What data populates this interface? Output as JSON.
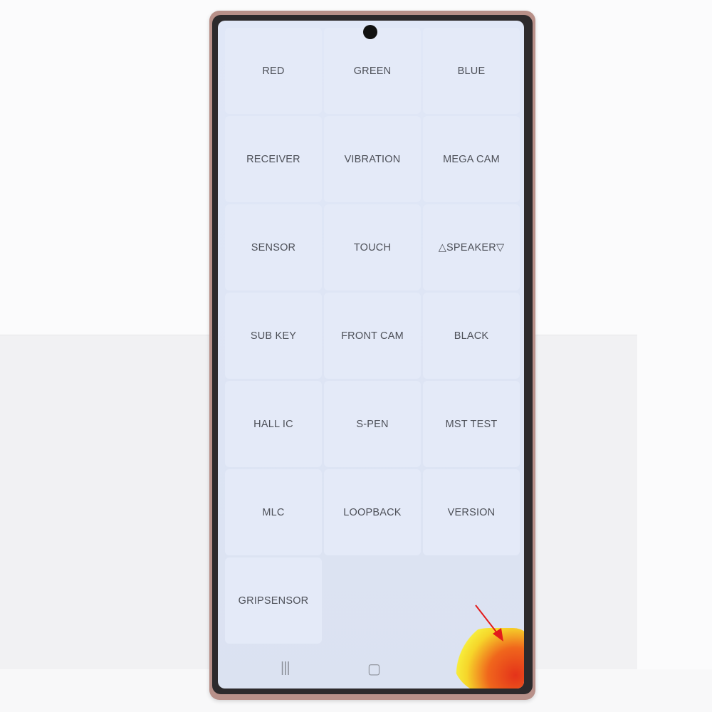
{
  "grid_items": [
    "RED",
    "GREEN",
    "BLUE",
    "RECEIVER",
    "VIBRATION",
    "MEGA CAM",
    "SENSOR",
    "TOUCH",
    "△SPEAKER▽",
    "SUB KEY",
    "FRONT CAM",
    "BLACK",
    "HALL IC",
    "S-PEN",
    "MST TEST",
    "MLC",
    "LOOPBACK",
    "VERSION",
    "GRIPSENSOR"
  ],
  "nav": {
    "recents": "|||",
    "home": "▢",
    "back": "<"
  },
  "colors": {
    "screen": "#dde4f4",
    "arrow": "#e31b1b",
    "phone_frame": "#b89089"
  }
}
